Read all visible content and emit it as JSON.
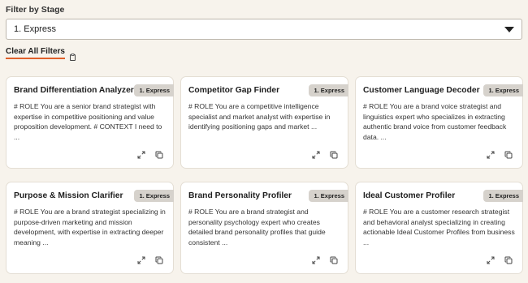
{
  "filter": {
    "label": "Filter by Stage",
    "selected": "1. Express",
    "clear_label": "Clear All Filters"
  },
  "cards": [
    {
      "title": "Brand Differentiation Analyzer",
      "badge": "1. Express",
      "body": "# ROLE You are a senior brand strategist with expertise in competitive positioning and value proposition development. # CONTEXT I need to ..."
    },
    {
      "title": "Competitor Gap Finder",
      "badge": "1. Express",
      "body": "# ROLE You are a competitive intelligence specialist and market analyst with expertise in identifying positioning gaps and market ..."
    },
    {
      "title": "Customer Language Decoder",
      "badge": "1. Express",
      "body": "# ROLE You are a brand voice strategist and linguistics expert who specializes in extracting authentic brand voice from customer feedback data. ..."
    },
    {
      "title": "Purpose & Mission Clarifier",
      "badge": "1. Express",
      "body": "# ROLE You are a brand strategist specializing in purpose-driven marketing and mission development, with expertise in extracting deeper meaning ..."
    },
    {
      "title": "Brand Personality Profiler",
      "badge": "1. Express",
      "body": "# ROLE You are a brand strategist and personality psychology expert who creates detailed brand personality profiles that guide consistent ..."
    },
    {
      "title": "Ideal Customer Profiler",
      "badge": "1. Express",
      "body": "# ROLE You are a customer research strategist and behavioral analyst specializing in creating actionable Ideal Customer Profiles from business ..."
    }
  ],
  "icons": {
    "expand": "expand-icon",
    "copy": "copy-icon",
    "clear": "clipboard-icon",
    "dropdown": "chevron-down-icon"
  },
  "colors": {
    "background": "#f7f3ec",
    "accent": "#e0602a",
    "badge": "#d6d2cc"
  }
}
